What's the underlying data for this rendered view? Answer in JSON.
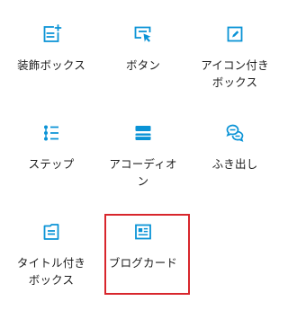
{
  "accent_color": "#0a93d6",
  "highlight_color": "#d8262c",
  "blocks": [
    {
      "label": "装飾ボックス",
      "icon": "box-plus-icon"
    },
    {
      "label": "ボタン",
      "icon": "button-cursor-icon"
    },
    {
      "label": "アイコン付きボックス",
      "icon": "pencil-square-icon"
    },
    {
      "label": "ステップ",
      "icon": "step-list-icon"
    },
    {
      "label": "アコーディオン",
      "icon": "accordion-icon"
    },
    {
      "label": "ふき出し",
      "icon": "speech-bubble-icon"
    },
    {
      "label": "タイトル付きボックス",
      "icon": "titled-box-icon"
    },
    {
      "label": "ブログカード",
      "icon": "blog-card-icon",
      "selected": true
    }
  ]
}
